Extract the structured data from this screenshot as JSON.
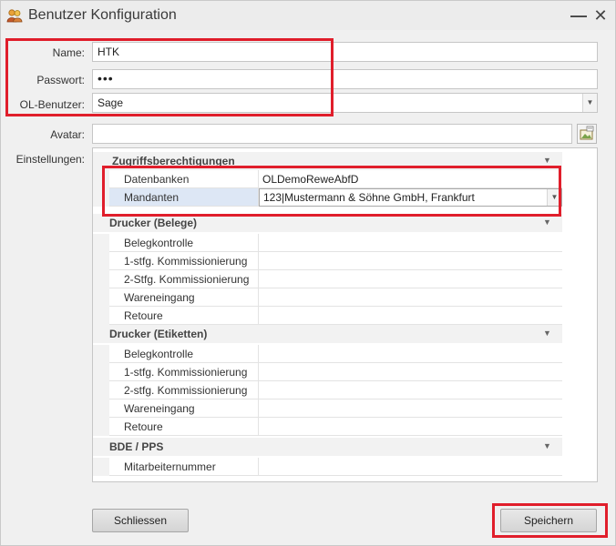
{
  "window": {
    "title": "Benutzer Konfiguration",
    "minimize_glyph": "—",
    "close_glyph": "✕"
  },
  "form": {
    "name_label": "Name:",
    "name_value": "HTK",
    "password_label": "Passwort:",
    "password_value": "•••",
    "ol_user_label": "OL-Benutzer:",
    "ol_user_value": "Sage",
    "avatar_label": "Avatar:",
    "avatar_value": "",
    "settings_label": "Einstellungen:"
  },
  "property_grid": {
    "access": {
      "title": "Zugriffsberechtigungen",
      "rows": [
        {
          "name": "Datenbanken",
          "value": "OLDemoReweAbfD"
        },
        {
          "name": "Mandanten",
          "value": "123|Mustermann & Söhne GmbH, Frankfurt"
        }
      ]
    },
    "printer_docs": {
      "title": "Drucker (Belege)",
      "rows": [
        {
          "name": "Belegkontrolle",
          "value": ""
        },
        {
          "name": "1-stfg. Kommissionierung",
          "value": ""
        },
        {
          "name": "2-Stfg. Kommissionierung",
          "value": ""
        },
        {
          "name": "Wareneingang",
          "value": ""
        },
        {
          "name": "Retoure",
          "value": ""
        }
      ]
    },
    "printer_labels": {
      "title": "Drucker (Etiketten)",
      "rows": [
        {
          "name": "Belegkontrolle",
          "value": ""
        },
        {
          "name": "1-stfg. Kommissionierung",
          "value": ""
        },
        {
          "name": "2-stfg. Kommissionierung",
          "value": ""
        },
        {
          "name": "Wareneingang",
          "value": ""
        },
        {
          "name": "Retoure",
          "value": ""
        }
      ]
    },
    "bde": {
      "title": "BDE / PPS",
      "rows": [
        {
          "name": "Mitarbeiternummer",
          "value": ""
        }
      ]
    }
  },
  "buttons": {
    "close": "Schliessen",
    "save": "Speichern"
  },
  "colors": {
    "highlight": "#e01e2b",
    "selected_row": "#dde7f5"
  },
  "icons": {
    "title": "users-icon",
    "avatar_browse": "browse-image-icon",
    "collapse": "chevron-down-icon",
    "dropdown": "dropdown-arrow-icon"
  }
}
